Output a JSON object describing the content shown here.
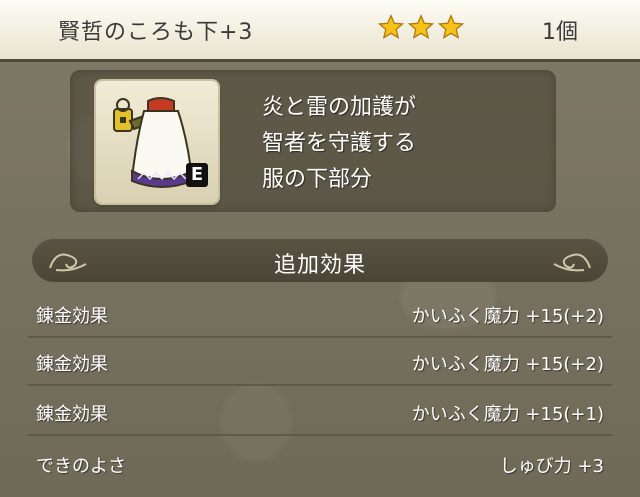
{
  "header": {
    "item_name": "賢哲のころも下+3",
    "star_count": 3,
    "count_text": "1個"
  },
  "item": {
    "icon": "robe-bottom-icon",
    "equipped_badge": "E",
    "description": [
      "炎と雷の加護が",
      "智者を守護する",
      "服の下部分"
    ]
  },
  "section": {
    "title": "追加効果"
  },
  "effects": [
    {
      "label": "錬金効果",
      "value": "かいふく魔力 +15(+2)"
    },
    {
      "label": "錬金効果",
      "value": "かいふく魔力 +15(+2)"
    },
    {
      "label": "錬金効果",
      "value": "かいふく魔力 +15(+1)"
    },
    {
      "label": "できのよさ",
      "value": "しゅび力 +3"
    }
  ],
  "colors": {
    "star": "#f5c21b",
    "panel": "#4a4536",
    "title_bg": "#f3efdc"
  }
}
